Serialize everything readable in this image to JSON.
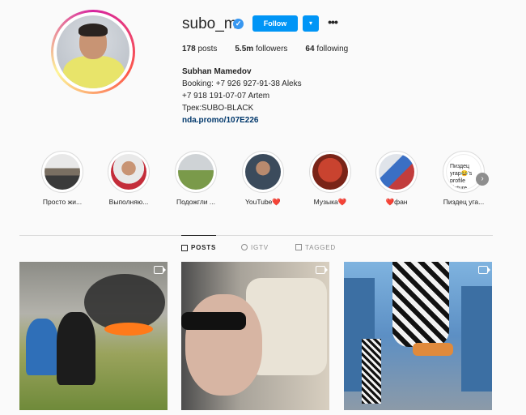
{
  "profile": {
    "username": "subo_m",
    "follow_label": "Follow",
    "dropdown_label": "▾",
    "more_label": "•••",
    "verified_label": "✓",
    "stats": {
      "posts_count": "178",
      "posts_label": "posts",
      "followers_count": "5.5m",
      "followers_label": "followers",
      "following_count": "64",
      "following_label": "following"
    },
    "bio": {
      "full_name": "Subhan Mamedov",
      "line1": "Booking: +7 926 927-91-38 Aleks",
      "line2": "+7 918 191-07-07 Artem",
      "line3": "Трек:SUBO-BLACK",
      "link": "nda.promo/107E226"
    }
  },
  "highlights": [
    {
      "label": "Просто жи..."
    },
    {
      "label": "Выполняю..."
    },
    {
      "label": "Подожгли ..."
    },
    {
      "label": "YouTube❤️"
    },
    {
      "label": "Музыка❤️"
    },
    {
      "label": "❤️фан"
    },
    {
      "label": "Пиздец уга...",
      "broken_text": "Пиздец угар😂's profile picture"
    }
  ],
  "next_arrow": "›",
  "tabs": [
    {
      "label": "POSTS"
    },
    {
      "label": "IGTV"
    },
    {
      "label": "TAGGED"
    }
  ],
  "colors": {
    "primary_button": "#0095f6",
    "link": "#00376b",
    "verified": "#3897f0"
  }
}
